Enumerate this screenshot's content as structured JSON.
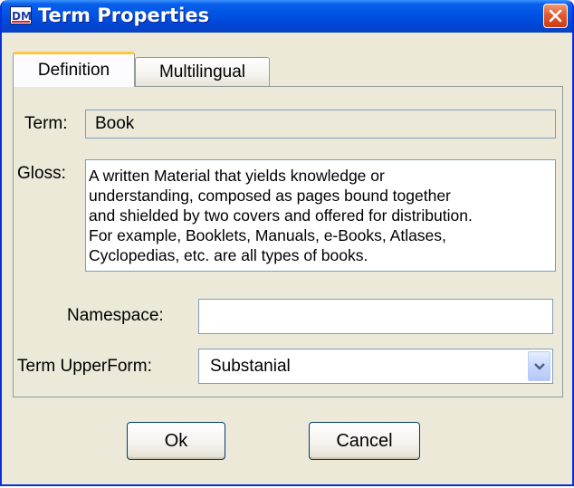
{
  "window": {
    "title": "Term Properties",
    "app_icon": "DM",
    "close_icon": "close-icon"
  },
  "tabs": [
    {
      "label": "Definition",
      "active": true
    },
    {
      "label": "Multilingual",
      "active": false
    }
  ],
  "form": {
    "term_label": "Term:",
    "term_value": "Book",
    "gloss_label": "Gloss:",
    "gloss_value": "A written Material that yields knowledge or\nunderstanding, composed as pages bound together\nand shielded by two covers and offered for distribution.\nFor example, Booklets, Manuals, e-Books, Atlases,\nCyclopedias, etc. are all types of books.",
    "namespace_label": "Namespace:",
    "namespace_value": "",
    "upperform_label": "Term UpperForm:",
    "upperform_value": "Substanial"
  },
  "buttons": {
    "ok_label": "Ok",
    "cancel_label": "Cancel"
  },
  "colors": {
    "titlebar": "#0055e5",
    "active_tab_accent": "#ffc83c",
    "dialog_background": "#ece9d8",
    "close_button": "#e15a2d"
  }
}
